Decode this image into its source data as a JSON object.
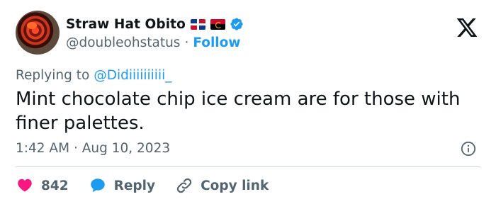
{
  "author": {
    "display_name": "Straw Hat Obito",
    "handle": "@doubleohstatus",
    "follow_label": "Follow",
    "separator": "·",
    "flags": [
      "dominican-republic-flag",
      "angola-flag"
    ],
    "verified_color": "#1d9bf0"
  },
  "tweet": {
    "replying_prefix": "Replying to",
    "replying_to": "@Didiiiiiiiiii_",
    "text": "Mint chocolate chip ice cream are for those with\nfiner palettes.",
    "time": "1:42 AM",
    "date": "Aug 10, 2023"
  },
  "actions": {
    "likes": "842",
    "reply_label": "Reply",
    "copy_label": "Copy link"
  },
  "colors": {
    "accent": "#1d9bf0",
    "like": "#f91880",
    "muted": "#536471",
    "text": "#0f1419"
  }
}
